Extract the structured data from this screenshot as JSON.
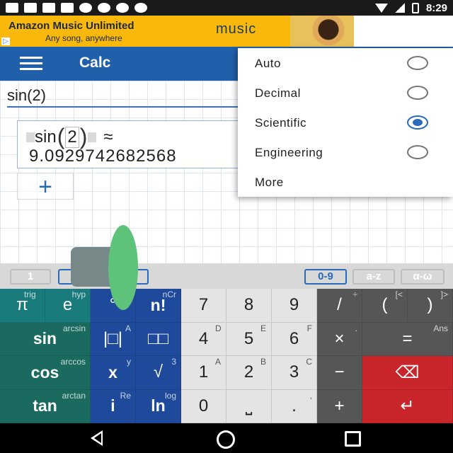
{
  "status_bar": {
    "time": "8:29"
  },
  "ad": {
    "headline": "Amazon Music Unlimited",
    "subline": "Any song, anywhere",
    "brand": "music"
  },
  "app_bar": {
    "title": "Calc"
  },
  "worksheet": {
    "input": "sin(2)",
    "result_fn": "sin",
    "result_arg": "2",
    "approx": "≈",
    "result_value": "9.0929742682568",
    "add_label": "+"
  },
  "keyboard_tabs": [
    {
      "label": "1"
    },
    {
      "label": "0-9",
      "active": true
    },
    {
      "label": "a-z"
    },
    {
      "label": "α-ω"
    }
  ],
  "keypad": {
    "rows": [
      [
        {
          "label": "π",
          "sup": "trig"
        },
        {
          "label": "e",
          "sup": "hyp"
        },
        {
          "label": "°",
          "sup": ""
        },
        {
          "label": "n!",
          "sup": "nCr"
        },
        {
          "label": "7",
          "sup": ""
        },
        {
          "label": "8",
          "sup": ""
        },
        {
          "label": "9",
          "sup": ""
        },
        {
          "label": "/",
          "sup": "÷"
        },
        {
          "label": "(",
          "sup": "[<"
        },
        {
          "label": ")",
          "sup": "]>"
        }
      ],
      [
        {
          "label": "sin",
          "sup": "arcsin"
        },
        {
          "label": "|□|",
          "sup": "A"
        },
        {
          "label": "□□",
          "sup": ""
        },
        {
          "label": "4",
          "sup": "D"
        },
        {
          "label": "5",
          "sup": "E"
        },
        {
          "label": "6",
          "sup": "F"
        },
        {
          "label": "×",
          "sup": "."
        },
        {
          "label": "=",
          "sup": "Ans"
        }
      ],
      [
        {
          "label": "cos",
          "sup": "arccos"
        },
        {
          "label": "x",
          "sup": "y"
        },
        {
          "label": "√",
          "sup": "3"
        },
        {
          "label": "1",
          "sup": "A"
        },
        {
          "label": "2",
          "sup": "B"
        },
        {
          "label": "3",
          "sup": "C"
        },
        {
          "label": "−",
          "sup": ""
        },
        {
          "label": "⌫",
          "sup": ""
        }
      ],
      [
        {
          "label": "tan",
          "sup": "arctan"
        },
        {
          "label": "i",
          "sup": "Re"
        },
        {
          "label": "ln",
          "sup": "log"
        },
        {
          "label": "0",
          "sup": ""
        },
        {
          "label": "⎵",
          "sup": ""
        },
        {
          "label": ".",
          "sup": ","
        },
        {
          "label": "+",
          "sup": ""
        },
        {
          "label": "↵",
          "sup": ""
        }
      ]
    ]
  },
  "menu": {
    "items": [
      {
        "label": "Auto",
        "selected": false
      },
      {
        "label": "Decimal",
        "selected": false
      },
      {
        "label": "Scientific",
        "selected": true
      },
      {
        "label": "Engineering",
        "selected": false
      },
      {
        "label": "More"
      }
    ]
  },
  "colors": {
    "app_bar": "#2060ab",
    "accent": "#2a6ab8",
    "key_green": "#1b6a5f",
    "key_blue": "#1f4a9b",
    "key_red": "#c8262a"
  }
}
